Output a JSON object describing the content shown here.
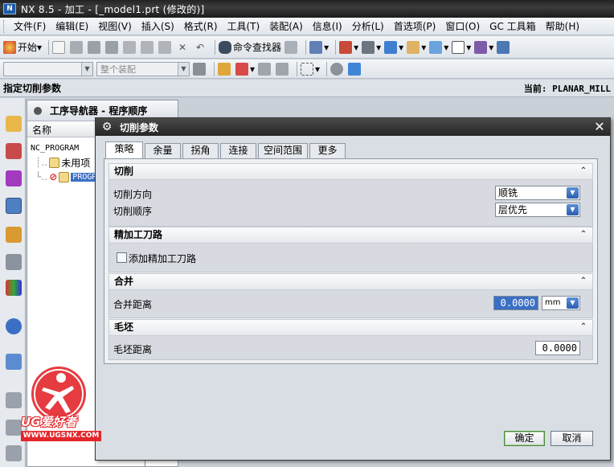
{
  "window": {
    "title": "NX 8.5 - 加工 - [_model1.prt (修改的)]"
  },
  "menu": [
    "文件(F)",
    "编辑(E)",
    "视图(V)",
    "插入(S)",
    "格式(R)",
    "工具(T)",
    "装配(A)",
    "信息(I)",
    "分析(L)",
    "首选项(P)",
    "窗口(O)",
    "GC 工具箱",
    "帮助(H)"
  ],
  "toolbar1": {
    "start_label": "开始",
    "command_finder_label": "命令查找器"
  },
  "toolbar2": {
    "assembly_combo_placeholder": "整个装配"
  },
  "cue": {
    "prompt": "指定切削参数",
    "current": "当前: PLANAR_MILL"
  },
  "navigator": {
    "title": "工序导航器 - 程序顺序",
    "column_name": "名称",
    "rows": [
      "NC_PROGRAM",
      "未用项",
      "PROGR"
    ]
  },
  "dialog": {
    "title": "切削参数",
    "tabs": [
      "策略",
      "余量",
      "拐角",
      "连接",
      "空间范围",
      "更多"
    ],
    "active_tab": "策略",
    "groups": {
      "cut": {
        "title": "切削",
        "direction_label": "切削方向",
        "direction_value": "顺铣",
        "order_label": "切削顺序",
        "order_value": "层优先"
      },
      "finish": {
        "title": "精加工刀路",
        "add_finish_label": "添加精加工刀路",
        "add_finish_checked": false
      },
      "merge": {
        "title": "合并",
        "distance_label": "合并距离",
        "distance_value": "0.0000",
        "unit": "mm"
      },
      "blank": {
        "title": "毛坯",
        "distance_label": "毛坯距离",
        "distance_value": "0.0000"
      }
    },
    "ok_label": "确定",
    "cancel_label": "取消"
  },
  "watermark": {
    "brand": "UG爱好者",
    "url": "WWW.UGSNX.COM"
  },
  "colors": {
    "title_bar": "#262626",
    "selected_field": "#3b6fc4",
    "watermark_red": "#e3262b"
  }
}
